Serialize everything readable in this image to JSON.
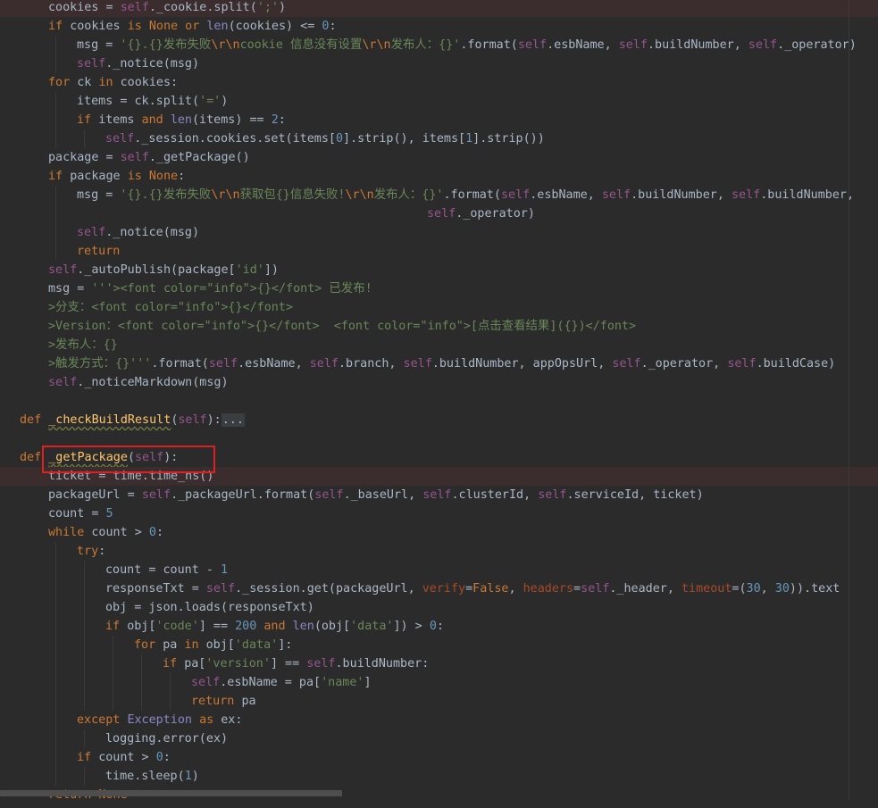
{
  "editor": {
    "language": "python",
    "theme_colors": {
      "background": "#2b2b2b",
      "keyword": "#cc7832",
      "self": "#94558d",
      "string": "#6a8759",
      "number": "#6897bb",
      "function": "#ffc66d",
      "text": "#a9b7c6",
      "highlight_box": "#e02020"
    },
    "highlighted_item": "_getPackage(self):",
    "folded_placeholder": "...",
    "lines": [
      {
        "indent": 1,
        "hl": true,
        "tokens": [
          [
            "cookies = ",
            ""
          ],
          [
            "self",
            "self"
          ],
          [
            "._cookie.split(",
            ""
          ],
          [
            "';'",
            "str"
          ],
          [
            ")",
            ""
          ]
        ]
      },
      {
        "indent": 1,
        "tokens": [
          [
            "if ",
            "kw"
          ],
          [
            "cookies ",
            ""
          ],
          [
            "is None or ",
            "kw"
          ],
          [
            "len",
            "bi"
          ],
          [
            "(cookies) <= ",
            ""
          ],
          [
            "0",
            "num"
          ],
          [
            ":",
            ""
          ]
        ]
      },
      {
        "indent": 2,
        "tokens": [
          [
            "msg = ",
            ""
          ],
          [
            "'{}.{}发布失败",
            "str"
          ],
          [
            "\\r\\n",
            "esc"
          ],
          [
            "cookie 信息没有设置",
            "str"
          ],
          [
            "\\r\\n",
            "esc"
          ],
          [
            "发布人：{}'",
            "str"
          ],
          [
            ".format(",
            ""
          ],
          [
            "self",
            "self"
          ],
          [
            ".esbName, ",
            ""
          ],
          [
            "self",
            "self"
          ],
          [
            ".buildNumber, ",
            ""
          ],
          [
            "self",
            "self"
          ],
          [
            "._operator)",
            ""
          ]
        ]
      },
      {
        "indent": 2,
        "tokens": [
          [
            "self",
            "self"
          ],
          [
            "._notice(msg)",
            ""
          ]
        ]
      },
      {
        "indent": 1,
        "tokens": [
          [
            "for ",
            "kw"
          ],
          [
            "ck ",
            ""
          ],
          [
            "in ",
            "kw"
          ],
          [
            "cookies:",
            ""
          ]
        ]
      },
      {
        "indent": 2,
        "tokens": [
          [
            "items = ck.split(",
            ""
          ],
          [
            "'='",
            "str"
          ],
          [
            ")",
            ""
          ]
        ]
      },
      {
        "indent": 2,
        "tokens": [
          [
            "if ",
            "kw"
          ],
          [
            "items ",
            ""
          ],
          [
            "and ",
            "kw"
          ],
          [
            "len",
            "bi"
          ],
          [
            "(items) == ",
            ""
          ],
          [
            "2",
            "num"
          ],
          [
            ":",
            ""
          ]
        ]
      },
      {
        "indent": 3,
        "tokens": [
          [
            "self",
            "self"
          ],
          [
            "._session.cookies.set(items[",
            ""
          ],
          [
            "0",
            "num"
          ],
          [
            "].strip(), items[",
            ""
          ],
          [
            "1",
            "num"
          ],
          [
            "].strip())",
            ""
          ]
        ]
      },
      {
        "indent": 1,
        "tokens": [
          [
            "package = ",
            ""
          ],
          [
            "self",
            "self"
          ],
          [
            "._getPackage()",
            ""
          ]
        ]
      },
      {
        "indent": 1,
        "tokens": [
          [
            "if ",
            "kw"
          ],
          [
            "package ",
            ""
          ],
          [
            "is None",
            "kw"
          ],
          [
            ":",
            ""
          ]
        ]
      },
      {
        "indent": 2,
        "tokens": [
          [
            "msg = ",
            ""
          ],
          [
            "'{}.{}发布失败",
            "str"
          ],
          [
            "\\r\\n",
            "esc"
          ],
          [
            "获取包{}信息失败!",
            "str"
          ],
          [
            "\\r\\n",
            "esc"
          ],
          [
            "发布人：{}'",
            "str"
          ],
          [
            ".format(",
            ""
          ],
          [
            "self",
            "self"
          ],
          [
            ".esbName, ",
            ""
          ],
          [
            "self",
            "self"
          ],
          [
            ".buildNumber, ",
            ""
          ],
          [
            "self",
            "self"
          ],
          [
            ".buildNumber,",
            ""
          ]
        ]
      },
      {
        "indent": 2,
        "pad": 392,
        "tokens": [
          [
            "self",
            "self"
          ],
          [
            "._operator)",
            ""
          ]
        ]
      },
      {
        "indent": 2,
        "tokens": [
          [
            "self",
            "self"
          ],
          [
            "._notice(msg)",
            ""
          ]
        ]
      },
      {
        "indent": 2,
        "tokens": [
          [
            "return",
            "kw"
          ]
        ]
      },
      {
        "indent": 1,
        "tokens": [
          [
            "self",
            "self"
          ],
          [
            "._autoPublish(package[",
            ""
          ],
          [
            "'id'",
            "str"
          ],
          [
            "])",
            ""
          ]
        ]
      },
      {
        "indent": 1,
        "tokens": [
          [
            "msg = ",
            ""
          ],
          [
            "'''><font color=\"info\">{}</font> 已发布!",
            "str"
          ]
        ]
      },
      {
        "indent": 1,
        "tokens": [
          [
            ">分支：<font color=\"info\">{}</font>",
            "str"
          ]
        ]
      },
      {
        "indent": 1,
        "tokens": [
          [
            ">Version：<font color=\"info\">{}</font>  <font color=\"info\">[点击查看结果]({})</font>",
            "str"
          ]
        ]
      },
      {
        "indent": 1,
        "tokens": [
          [
            ">发布人：{}",
            "str"
          ]
        ]
      },
      {
        "indent": 1,
        "tokens": [
          [
            ">触发方式：{}'''",
            "str"
          ],
          [
            ".format(",
            ""
          ],
          [
            "self",
            "self"
          ],
          [
            ".esbName, ",
            ""
          ],
          [
            "self",
            "self"
          ],
          [
            ".branch, ",
            ""
          ],
          [
            "self",
            "self"
          ],
          [
            ".buildNumber, appOpsUrl, ",
            ""
          ],
          [
            "self",
            "self"
          ],
          [
            "._operator, ",
            ""
          ],
          [
            "self",
            "self"
          ],
          [
            ".buildCase)",
            ""
          ]
        ]
      },
      {
        "indent": 1,
        "tokens": [
          [
            "self",
            "self"
          ],
          [
            "._noticeMarkdown(msg)",
            ""
          ]
        ]
      },
      {
        "indent": 0,
        "tokens": []
      },
      {
        "indent": 0,
        "tokens": [
          [
            "def ",
            "kw"
          ],
          [
            "_checkBuildResult",
            "fnu"
          ],
          [
            "(",
            ""
          ],
          [
            "self",
            "self"
          ],
          [
            "):",
            ""
          ],
          [
            "...",
            "fold"
          ]
        ]
      },
      {
        "indent": 0,
        "tokens": []
      },
      {
        "indent": 0,
        "tokens": [
          [
            "def ",
            "kw"
          ],
          [
            "_getPackage",
            "fnu"
          ],
          [
            "(",
            ""
          ],
          [
            "self",
            "self"
          ],
          [
            "):",
            ""
          ]
        ]
      },
      {
        "indent": 1,
        "hl": true,
        "tokens": [
          [
            "ticket = time.time_ns()",
            ""
          ]
        ]
      },
      {
        "indent": 1,
        "tokens": [
          [
            "packageUrl = ",
            ""
          ],
          [
            "self",
            "self"
          ],
          [
            "._packageUrl.format(",
            ""
          ],
          [
            "self",
            "self"
          ],
          [
            "._baseUrl, ",
            ""
          ],
          [
            "self",
            "self"
          ],
          [
            ".clusterId, ",
            ""
          ],
          [
            "self",
            "self"
          ],
          [
            ".serviceId, ticket)",
            ""
          ]
        ]
      },
      {
        "indent": 1,
        "tokens": [
          [
            "count = ",
            ""
          ],
          [
            "5",
            "num"
          ]
        ]
      },
      {
        "indent": 1,
        "tokens": [
          [
            "while ",
            "kw"
          ],
          [
            "count > ",
            ""
          ],
          [
            "0",
            "num"
          ],
          [
            ":",
            ""
          ]
        ]
      },
      {
        "indent": 2,
        "tokens": [
          [
            "try",
            "kw"
          ],
          [
            ":",
            ""
          ]
        ]
      },
      {
        "indent": 3,
        "tokens": [
          [
            "count = count - ",
            ""
          ],
          [
            "1",
            "num"
          ]
        ]
      },
      {
        "indent": 3,
        "tokens": [
          [
            "responseTxt = ",
            ""
          ],
          [
            "self",
            "self"
          ],
          [
            "._session.get(packageUrl, ",
            ""
          ],
          [
            "verify",
            "kwa"
          ],
          [
            "=",
            ""
          ],
          [
            "False",
            "kw"
          ],
          [
            ", ",
            ""
          ],
          [
            "headers",
            "kwa"
          ],
          [
            "=",
            ""
          ],
          [
            "self",
            "self"
          ],
          [
            "._header, ",
            ""
          ],
          [
            "timeout",
            "kwa"
          ],
          [
            "=(",
            ""
          ],
          [
            "30",
            "num"
          ],
          [
            ", ",
            ""
          ],
          [
            "30",
            "num"
          ],
          [
            ")).text",
            ""
          ]
        ]
      },
      {
        "indent": 3,
        "tokens": [
          [
            "obj = json.loads(responseTxt)",
            ""
          ]
        ]
      },
      {
        "indent": 3,
        "tokens": [
          [
            "if ",
            "kw"
          ],
          [
            "obj[",
            ""
          ],
          [
            "'code'",
            "str"
          ],
          [
            "] == ",
            ""
          ],
          [
            "200 ",
            "num"
          ],
          [
            "and ",
            "kw"
          ],
          [
            "len",
            "bi"
          ],
          [
            "(obj[",
            ""
          ],
          [
            "'data'",
            "str"
          ],
          [
            "]) > ",
            ""
          ],
          [
            "0",
            "num"
          ],
          [
            ":",
            ""
          ]
        ]
      },
      {
        "indent": 4,
        "tokens": [
          [
            "for ",
            "kw"
          ],
          [
            "pa ",
            ""
          ],
          [
            "in ",
            "kw"
          ],
          [
            "obj[",
            ""
          ],
          [
            "'data'",
            "str"
          ],
          [
            "]:",
            ""
          ]
        ]
      },
      {
        "indent": 5,
        "tokens": [
          [
            "if ",
            "kw"
          ],
          [
            "pa[",
            ""
          ],
          [
            "'version'",
            "str"
          ],
          [
            "] == ",
            ""
          ],
          [
            "self",
            "self"
          ],
          [
            ".buildNumber:",
            ""
          ]
        ]
      },
      {
        "indent": 6,
        "tokens": [
          [
            "self",
            "self"
          ],
          [
            ".esbName = pa[",
            ""
          ],
          [
            "'name'",
            "str"
          ],
          [
            "]",
            ""
          ]
        ]
      },
      {
        "indent": 6,
        "tokens": [
          [
            "return ",
            "kw"
          ],
          [
            "pa",
            ""
          ]
        ]
      },
      {
        "indent": 2,
        "tokens": [
          [
            "except ",
            "kw"
          ],
          [
            "Exception ",
            "bi"
          ],
          [
            "as ",
            "kw"
          ],
          [
            "ex:",
            ""
          ]
        ]
      },
      {
        "indent": 3,
        "tokens": [
          [
            "logging.error(ex)",
            ""
          ]
        ]
      },
      {
        "indent": 2,
        "tokens": [
          [
            "if ",
            "kw"
          ],
          [
            "count > ",
            ""
          ],
          [
            "0",
            "num"
          ],
          [
            ":",
            ""
          ]
        ]
      },
      {
        "indent": 3,
        "tokens": [
          [
            "time.sleep(",
            ""
          ],
          [
            "1",
            "num"
          ],
          [
            ")",
            ""
          ]
        ]
      },
      {
        "indent": 1,
        "tokens": [
          [
            "return None",
            "kw"
          ]
        ]
      }
    ]
  }
}
